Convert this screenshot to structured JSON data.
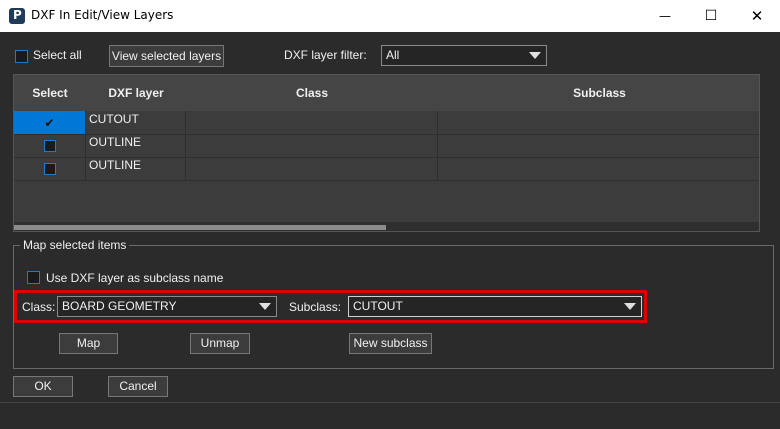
{
  "window": {
    "title": "DXF In Edit/View Layers",
    "minimize_glyph": "—",
    "maximize_glyph": "☐",
    "close_glyph": "✕"
  },
  "toolbar": {
    "select_all_label": "Select all",
    "select_all_checked": false,
    "view_selected_label": "View selected layers",
    "filter_label": "DXF layer filter:",
    "filter_value": "All"
  },
  "table": {
    "columns": [
      "Select",
      "DXF layer",
      "Class",
      "Subclass"
    ],
    "rows": [
      {
        "selected": true,
        "check_glyph": "✔",
        "layer": "CUTOUT",
        "class": "",
        "subclass": ""
      },
      {
        "selected": false,
        "check_glyph": "",
        "layer": "OUTLINE",
        "class": "",
        "subclass": ""
      },
      {
        "selected": false,
        "check_glyph": "",
        "layer": "OUTLINE",
        "class": "",
        "subclass": ""
      }
    ]
  },
  "map_group": {
    "title": "Map selected items",
    "use_subclass_label": "Use DXF layer as subclass name",
    "use_subclass_checked": false,
    "class_label": "Class:",
    "class_value": "BOARD GEOMETRY",
    "subclass_label": "Subclass:",
    "subclass_value": "CUTOUT",
    "map_button": "Map",
    "unmap_button": "Unmap",
    "new_subclass_button": "New subclass"
  },
  "footer": {
    "ok_button": "OK",
    "cancel_button": "Cancel"
  },
  "colors": {
    "selection": "#0078d7",
    "highlight": "#e00000",
    "background": "#2b2b2b"
  }
}
